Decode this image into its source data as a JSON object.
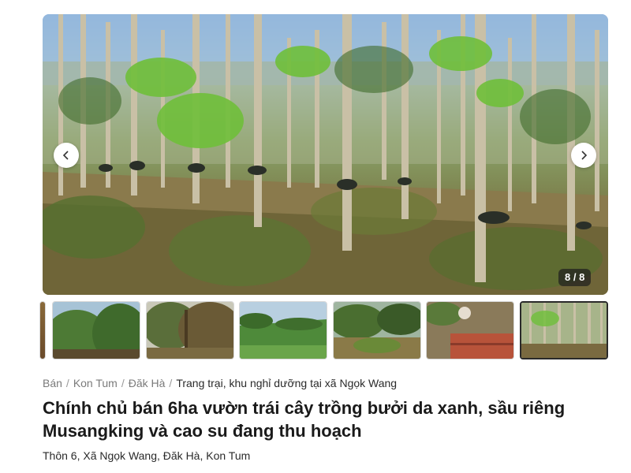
{
  "gallery": {
    "counter": "8 / 8",
    "prev_icon": "chevron-left-icon",
    "next_icon": "chevron-right-icon"
  },
  "breadcrumb": {
    "items": [
      "Bán",
      "Kon Tum",
      "Đăk Hà"
    ],
    "separator": "/",
    "current": "Trang trại, khu nghỉ dưỡng tại xã Ngọk Wang"
  },
  "listing": {
    "title": "Chính chủ bán 6ha vườn trái cây trồng bưởi da xanh, sầu riêng Musangking và cao su đang thu hoạch",
    "address": "Thôn 6, Xã Ngọk Wang, Đăk Hà, Kon Tum"
  }
}
